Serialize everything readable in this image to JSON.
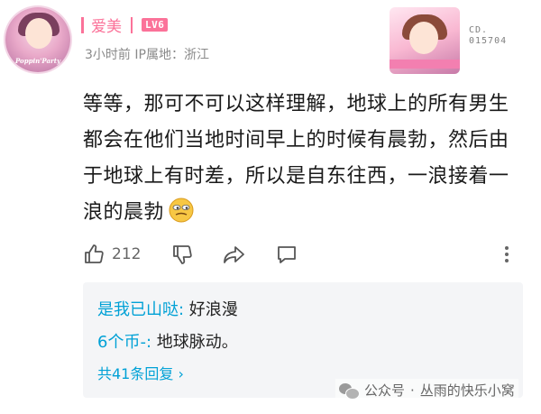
{
  "user": {
    "name": "爱美",
    "level": "LV6",
    "time": "3小时前",
    "location_label": "IP属地：浙江",
    "avatar_tag": "Poppin'Party"
  },
  "badge": {
    "code_line1": "CD.",
    "code_line2": "015704"
  },
  "comment": {
    "text": "等等，那可不可以这样理解，地球上的所有男生都会在他们当地时间早上的时候有晨勃，然后由于地球上有时差，所以是自东往西，一浪接着一浪的晨勃"
  },
  "actions": {
    "like_count": "212",
    "icons": [
      "thumbs-up-icon",
      "thumbs-down-icon",
      "share-icon",
      "reply-icon",
      "more-icon"
    ]
  },
  "replies": {
    "items": [
      {
        "user": "是我已山哒:",
        "text": " 好浪漫"
      },
      {
        "user": "6个币-:",
        "text": " 地球脉动。"
      }
    ],
    "more_label": "共41条回复 ›"
  },
  "watermark": {
    "source": "公众号",
    "sep": "·",
    "name": "丛雨的快乐小窝"
  },
  "colors": {
    "accent_pink": "#fb7299",
    "link_blue": "#00a1d6",
    "reply_bg": "#f4f5f7"
  }
}
